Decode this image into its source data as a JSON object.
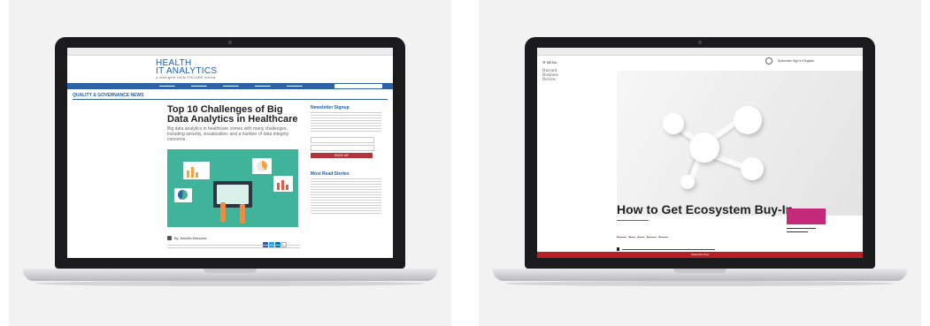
{
  "left": {
    "brand_line1": "HEALTH",
    "brand_line2": "IT ANALYTICS",
    "brand_tag": "a xtelligent HEALTHCARE media",
    "section": "QUALITY & GOVERNANCE NEWS",
    "headline": "Top 10 Challenges of Big Data Analytics in Healthcare",
    "subhead": "Big data analytics in healthcare comes with many challenges, including security, visualization, and a number of data integrity concerns.",
    "byline": "By Jennifer Bresnick",
    "sidebar_signup": "Newsletter Signup",
    "sign_up_button": "SIGN UP",
    "sidebar_most_read": "Most Read Stories"
  },
  "right": {
    "menu_label": "MENU",
    "logo_line1": "Harvard",
    "logo_line2": "Business",
    "logo_line3": "Review",
    "account_links": "Subscribe  Sign In  Register",
    "headline": "How to Get Ecosystem Buy-In",
    "footer_text": "Subscribe Now"
  }
}
